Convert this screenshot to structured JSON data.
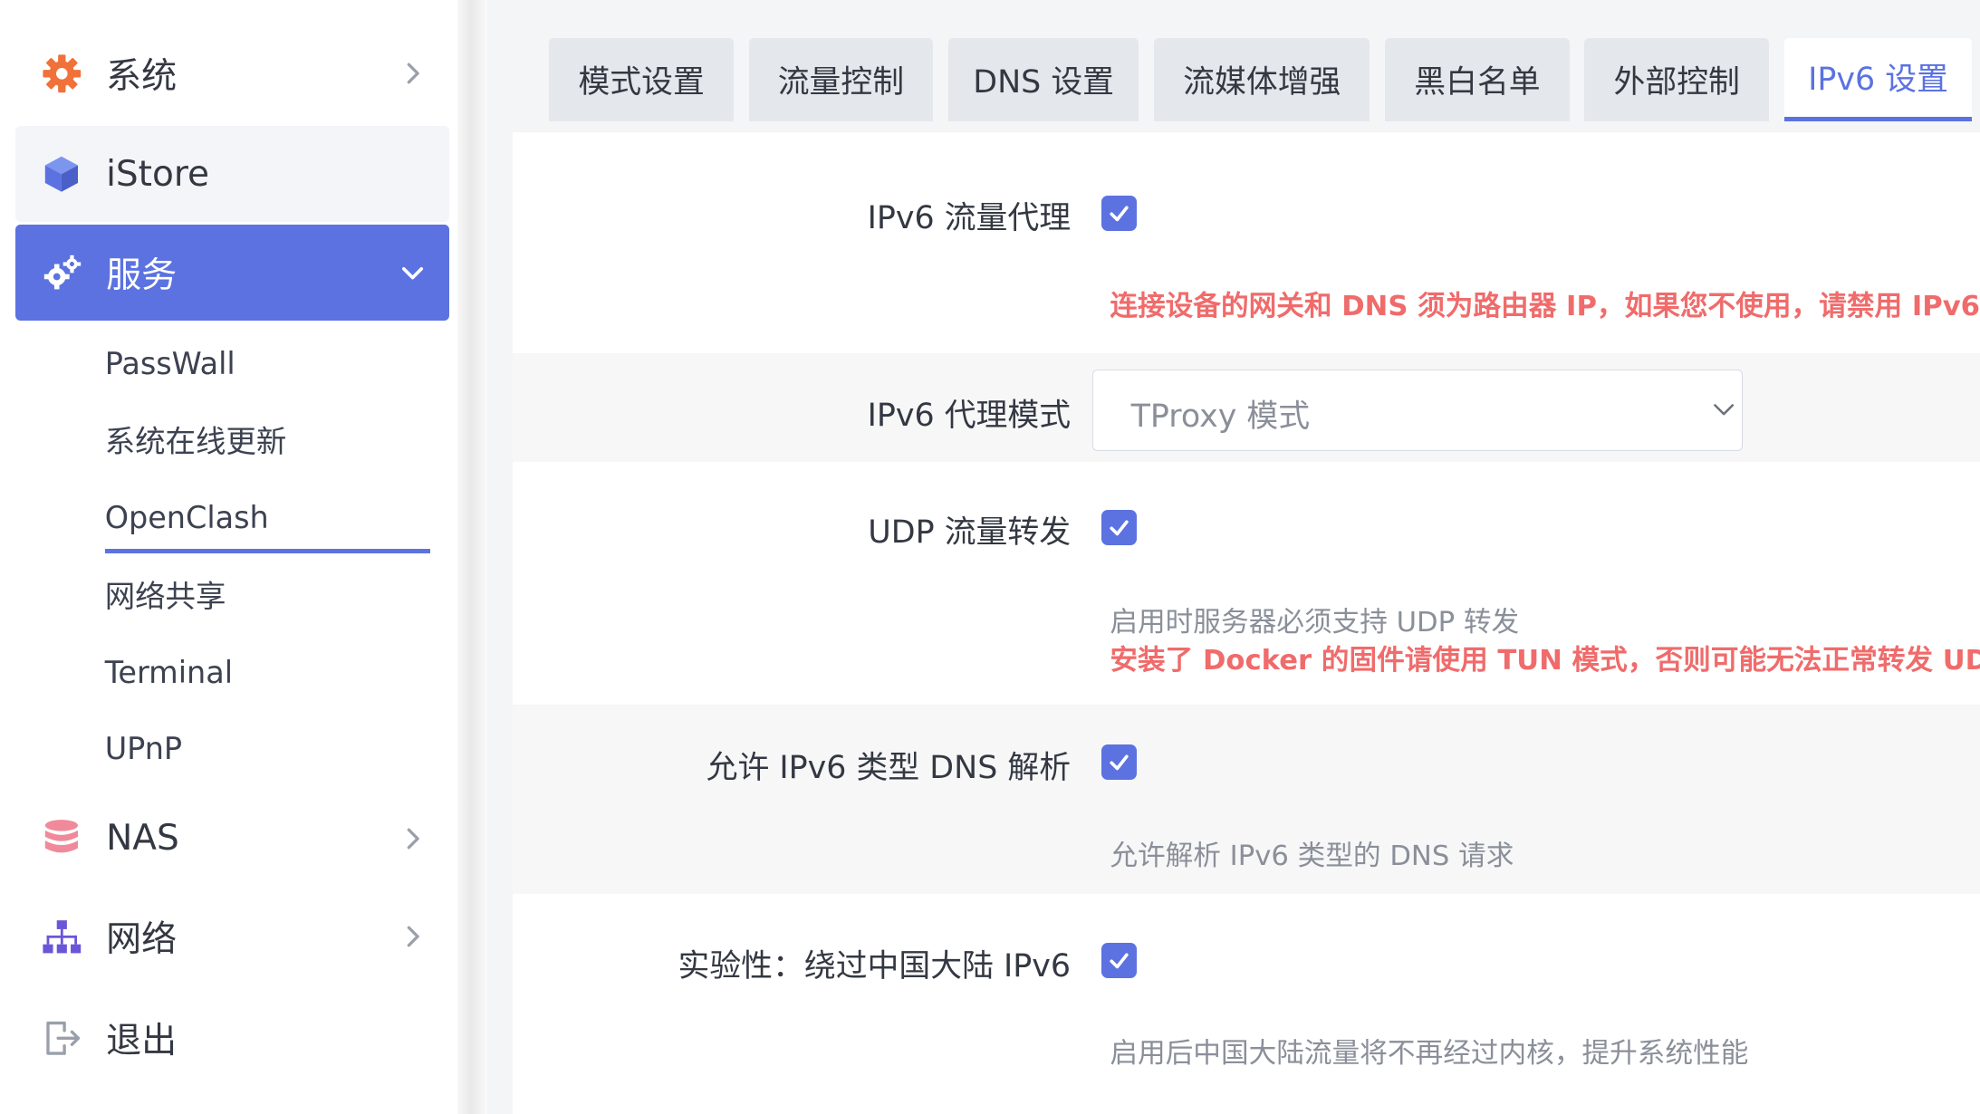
{
  "sidebar": {
    "items": [
      {
        "label": "系统"
      },
      {
        "label": "iStore"
      },
      {
        "label": "服务"
      },
      {
        "label": "NAS"
      },
      {
        "label": "网络"
      },
      {
        "label": "退出"
      }
    ],
    "submenu": [
      "PassWall",
      "系统在线更新",
      "OpenClash",
      "网络共享",
      "Terminal",
      "UPnP"
    ],
    "active_submenu": "OpenClash"
  },
  "tabs": [
    "模式设置",
    "流量控制",
    "DNS 设置",
    "流媒体增强",
    "黑白名单",
    "外部控制",
    "IPv6 设置"
  ],
  "active_tab": "IPv6 设置",
  "settings": {
    "ipv6_proxy": {
      "label": "IPv6 流量代理",
      "checked": true,
      "warning": "连接设备的网关和 DNS 须为路由器 IP，如果您不使用，请禁用 IPv6"
    },
    "ipv6_mode": {
      "label": "IPv6 代理模式",
      "value": "TProxy 模式"
    },
    "udp_forward": {
      "label": "UDP 流量转发",
      "checked": true,
      "desc": "启用时服务器必须支持 UDP 转发",
      "warning": "安装了 Docker 的固件请使用 TUN 模式，否则可能无法正常转发 UDP"
    },
    "ipv6_dns": {
      "label": "允许 IPv6 类型 DNS 解析",
      "checked": true,
      "desc": "允许解析 IPv6 类型的 DNS 请求"
    },
    "bypass_cn": {
      "label": "实验性：绕过中国大陆 IPv6",
      "checked": true,
      "desc": "启用后中国大陆流量将不再经过内核，提升系统性能"
    }
  },
  "colors": {
    "accent": "#5b72e0",
    "warning": "#f06b6b"
  }
}
